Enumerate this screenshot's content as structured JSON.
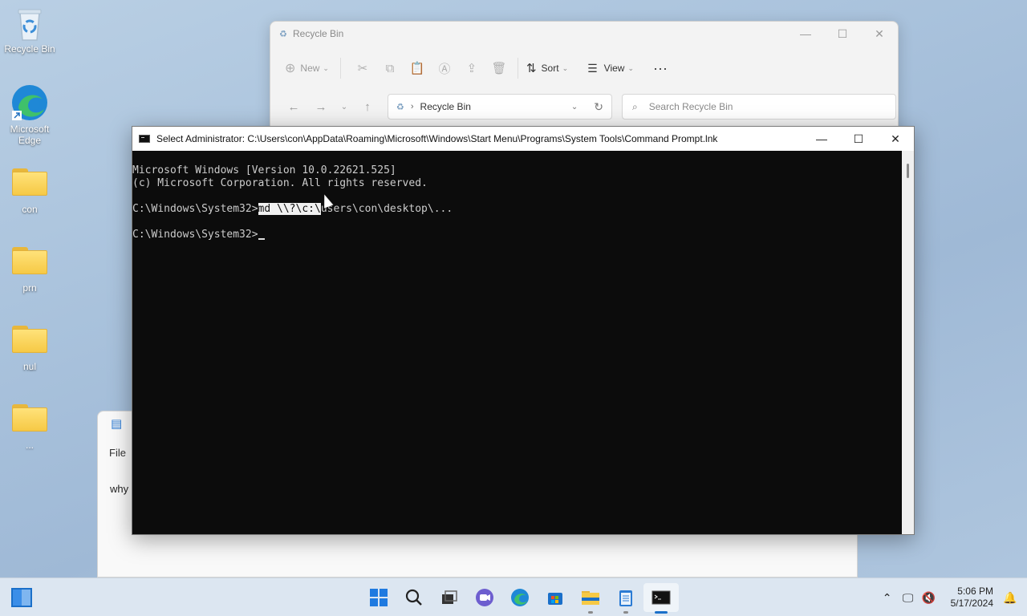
{
  "desktop_icons": [
    {
      "label": "Recycle Bin",
      "icon": "recycle-bin-icon"
    },
    {
      "label": "Microsoft Edge",
      "icon": "edge-icon"
    },
    {
      "label": "con",
      "icon": "folder-icon"
    },
    {
      "label": "prn",
      "icon": "folder-icon"
    },
    {
      "label": "nul",
      "icon": "folder-icon"
    },
    {
      "label": "...",
      "icon": "folder-icon"
    }
  ],
  "explorer": {
    "title": "Recycle Bin",
    "toolbar": {
      "new": "New",
      "sort": "Sort",
      "view": "View"
    },
    "address": "Recycle Bin",
    "search_placeholder": "Search Recycle Bin"
  },
  "notepad": {
    "menu_file": "File",
    "text": "why"
  },
  "cmd": {
    "title": "Select Administrator: C:\\Users\\con\\AppData\\Roaming\\Microsoft\\Windows\\Start Menu\\Programs\\System Tools\\Command Prompt.lnk",
    "lines": {
      "l1": "Microsoft Windows [Version 10.0.22621.525]",
      "l2": "(c) Microsoft Corporation. All rights reserved.",
      "prompt": "C:\\Windows\\System32>",
      "selected": "md \\\\?\\c:\\",
      "rest": "users\\con\\desktop\\...",
      "prompt2": "C:\\Windows\\System32>"
    }
  },
  "taskbar": {
    "time": "5:06 PM",
    "date": "5/17/2024"
  }
}
